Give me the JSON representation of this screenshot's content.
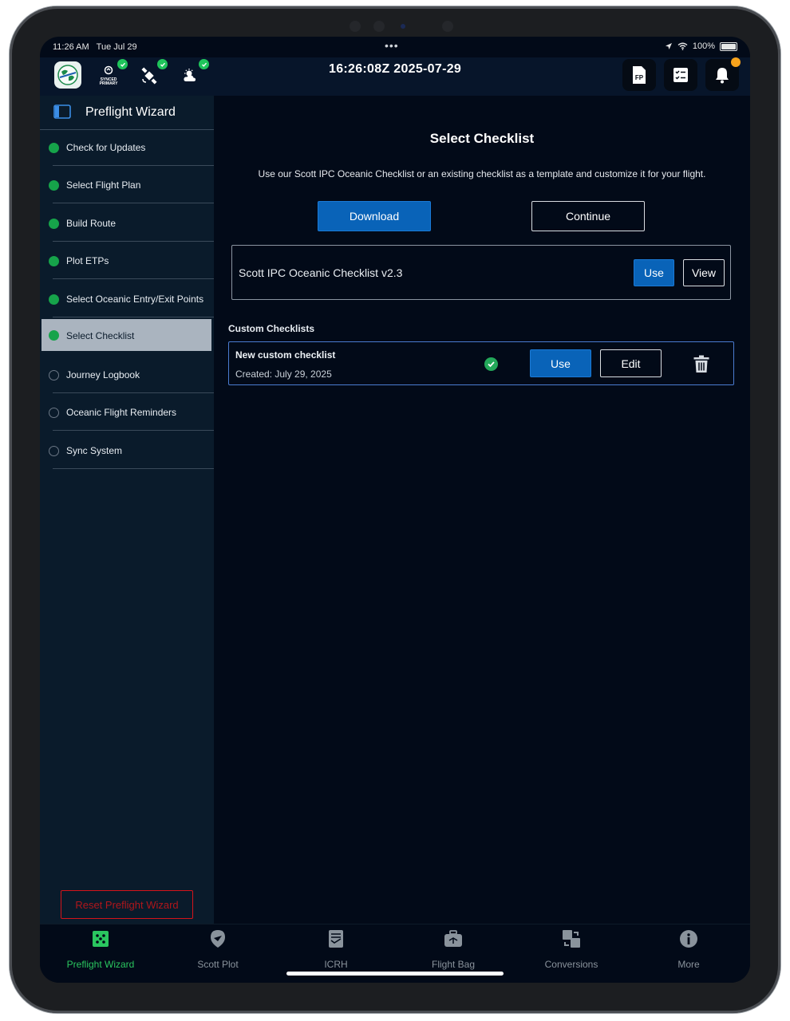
{
  "status_bar": {
    "time": "11:26 AM",
    "date": "Tue Jul 29",
    "battery": "100%"
  },
  "top_bar": {
    "synced_label_1": "SYNCED",
    "synced_label_2": "PRIMARY",
    "clock": "16:26:08Z  2025-07-29",
    "fp_label": "FP"
  },
  "sidebar": {
    "title": "Preflight Wizard",
    "items": [
      {
        "label": "Check for Updates",
        "done": true
      },
      {
        "label": "Select Flight Plan",
        "done": true
      },
      {
        "label": "Build Route",
        "done": true
      },
      {
        "label": "Plot ETPs",
        "done": true
      },
      {
        "label": "Select Oceanic Entry/Exit Points",
        "done": true
      },
      {
        "label": "Select Checklist",
        "done": true,
        "active": true
      },
      {
        "label": "Journey Logbook",
        "done": false
      },
      {
        "label": "Oceanic Flight Reminders",
        "done": false
      },
      {
        "label": "Sync System",
        "done": false
      }
    ],
    "reset_label": "Reset Preflight Wizard"
  },
  "main": {
    "title": "Select Checklist",
    "description": "Use our Scott IPC Oceanic Checklist or an existing checklist as a template and customize it for your flight.",
    "download_label": "Download",
    "continue_label": "Continue",
    "template": {
      "name": "Scott IPC Oceanic Checklist v2.3",
      "use_label": "Use",
      "view_label": "View"
    },
    "custom_section_title": "Custom Checklists",
    "custom": {
      "name": "New custom checklist",
      "created": "Created: July 29, 2025",
      "use_label": "Use",
      "edit_label": "Edit"
    }
  },
  "tabs": [
    {
      "label": "Preflight Wizard",
      "icon": "wizard-icon",
      "active": true
    },
    {
      "label": "Scott Plot",
      "icon": "plot-icon"
    },
    {
      "label": "ICRH",
      "icon": "icrh-icon"
    },
    {
      "label": "Flight Bag",
      "icon": "flight-bag-icon"
    },
    {
      "label": "Conversions",
      "icon": "conversions-icon"
    },
    {
      "label": "More",
      "icon": "more-icon"
    }
  ],
  "colors": {
    "accent_blue": "#0963b8",
    "done_green": "#16a34a",
    "active_tab_green": "#2ac65f",
    "reset_red": "#d4141a",
    "notification_orange": "#f7a31c"
  }
}
